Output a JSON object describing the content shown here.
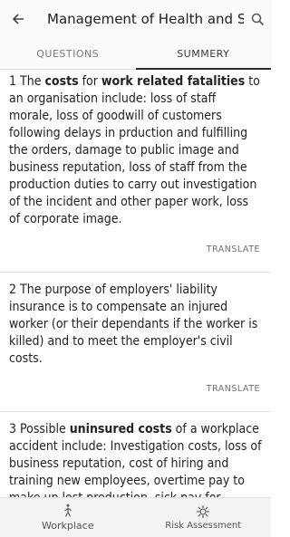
{
  "appbar": {
    "title": "Management of Health and Sa..."
  },
  "tabs": [
    {
      "label": "QUESTIONS"
    },
    {
      "label": "SUMMERY"
    }
  ],
  "cards": [
    {
      "number": "1",
      "segments": [
        {
          "t": " The ",
          "b": false
        },
        {
          "t": "costs",
          "b": true
        },
        {
          "t": " for ",
          "b": false
        },
        {
          "t": "work related fatalities",
          "b": true
        },
        {
          "t": " to an organisation include: loss of staff morale, loss of goodwill of customers following delays in prduction and fulfilling the orders, damage to public image and business reputation, loss of staff from the production duties to carry out investigation of the incident and other paper work, loss of corporate image.",
          "b": false
        }
      ],
      "translate": "TRANSLATE"
    },
    {
      "number": "2",
      "segments": [
        {
          "t": " The purpose of employers' liability insurance is to compensate an injured worker (or their dependants if the worker is killed) and to meet the employer's civil costs.",
          "b": false
        }
      ],
      "translate": "TRANSLATE"
    },
    {
      "number": "3",
      "segments": [
        {
          "t": " Possible ",
          "b": false
        },
        {
          "t": "uninsured costs",
          "b": true
        },
        {
          "t": " of a workplace accident include: Investigation costs, loss of business reputation, cost of hiring and training new employees, overtime pay to make up lost production, sick pay for injured workers, potential fines and legal",
          "b": false
        }
      ],
      "translate": "TRANSLATE"
    }
  ],
  "bottomnav": [
    {
      "label": "Workplace",
      "icon": "workplace-person-icon"
    },
    {
      "label": "Risk Assessment",
      "icon": "risk-assessment-icon"
    }
  ]
}
